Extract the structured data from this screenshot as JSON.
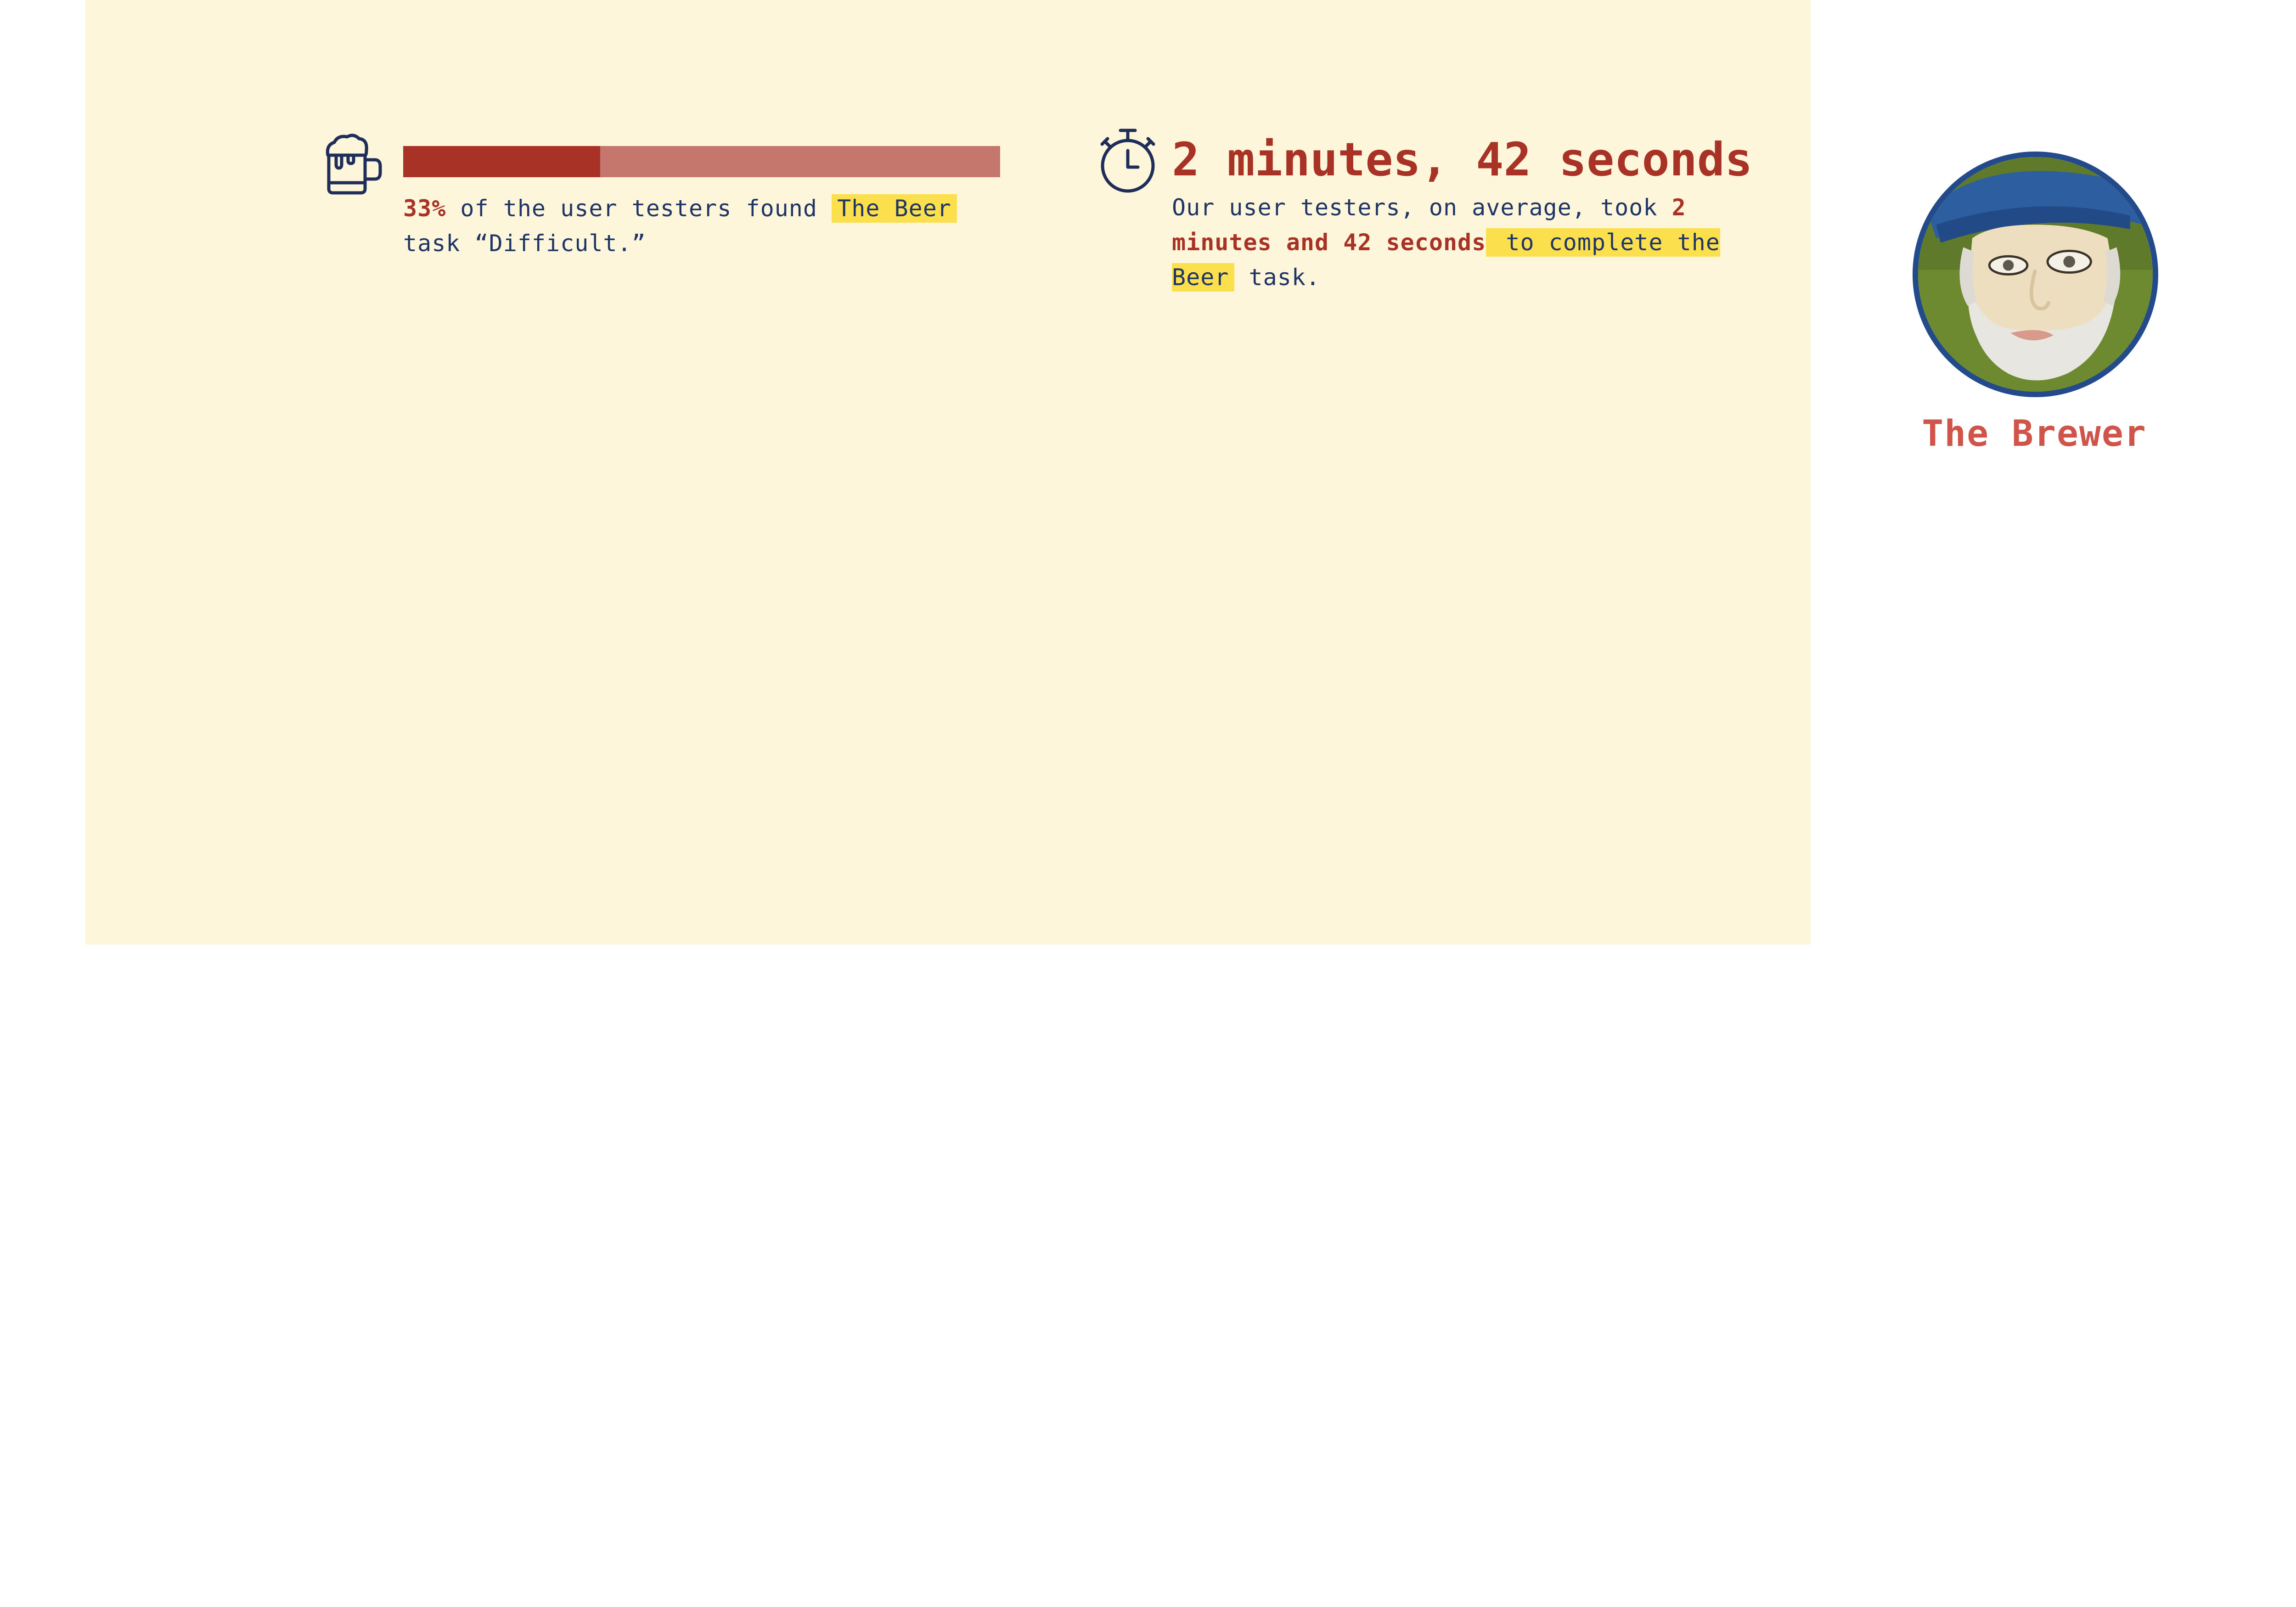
{
  "difficulty": {
    "percent_text": "33%",
    "fraction": 0.33,
    "text_before": " of the user testers found ",
    "highlight": "The Beer",
    "text_after": " task “Difficult.”",
    "colors": {
      "fill": "#a83226",
      "track": "#c5776d",
      "highlight": "#fcdf4c",
      "text": "#1e3566"
    }
  },
  "time": {
    "title": "2 minutes, 42 seconds",
    "text_before": "Our user testers, on average, took ",
    "accent": "2 minutes and 42 seconds",
    "highlight": " to complete the Beer",
    "text_after": " task.",
    "colors": {
      "accent": "#a83226"
    }
  },
  "profile": {
    "name": "The Brewer",
    "avatar_icon": "brewer-portrait",
    "colors": {
      "ring": "#234a8a",
      "name": "#d0544a"
    }
  },
  "icons": {
    "mug": "beer-mug-icon",
    "timer": "stopwatch-icon"
  },
  "colors": {
    "panel": "#fdf6da",
    "page": "#ffffff"
  }
}
